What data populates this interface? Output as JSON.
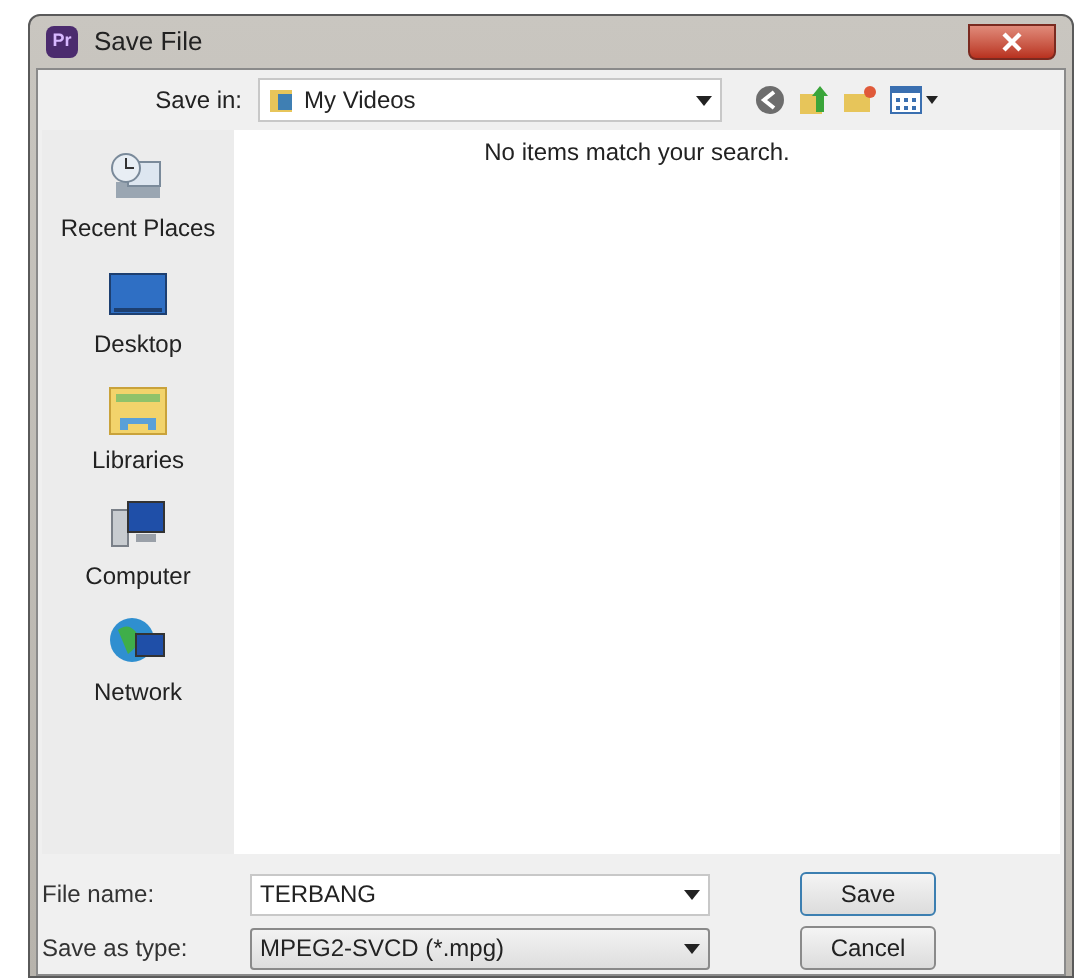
{
  "window": {
    "title": "Save File",
    "app_badge": "Pr"
  },
  "save_in": {
    "label": "Save in:",
    "value": "My Videos"
  },
  "places": [
    {
      "label": "Recent Places",
      "kind": "recent"
    },
    {
      "label": "Desktop",
      "kind": "desktop"
    },
    {
      "label": "Libraries",
      "kind": "libraries"
    },
    {
      "label": "Computer",
      "kind": "computer"
    },
    {
      "label": "Network",
      "kind": "network"
    }
  ],
  "file_list": {
    "empty_message": "No items match your search."
  },
  "file_name": {
    "label": "File name:",
    "value": "TERBANG"
  },
  "save_as_type": {
    "label": "Save as type:",
    "value": "MPEG2-SVCD (*.mpg)"
  },
  "buttons": [
    "Save",
    "Cancel"
  ]
}
